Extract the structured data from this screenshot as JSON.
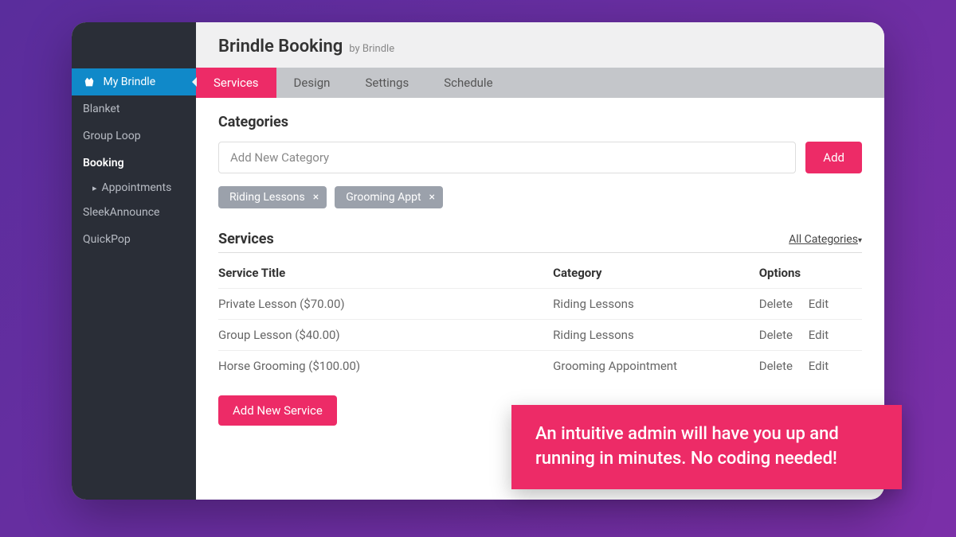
{
  "sidebar": {
    "brand": "My Brindle",
    "items": [
      "Blanket",
      "Group Loop",
      "Booking",
      "SleekAnnounce",
      "QuickPop"
    ],
    "sub_booking": "Appointments"
  },
  "header": {
    "title": "Brindle Booking",
    "by": "by Brindle"
  },
  "tabs": [
    "Services",
    "Design",
    "Settings",
    "Schedule"
  ],
  "categories": {
    "title": "Categories",
    "placeholder": "Add New Category",
    "add_label": "Add",
    "tags": [
      "Riding Lessons",
      "Grooming Appt"
    ]
  },
  "services": {
    "title": "Services",
    "filter_label": "All Categories",
    "columns": [
      "Service Title",
      "Category",
      "Options"
    ],
    "rows": [
      {
        "title": "Private Lesson ($70.00)",
        "category": "Riding Lessons"
      },
      {
        "title": "Group Lesson ($40.00)",
        "category": "Riding Lessons"
      },
      {
        "title": "Horse Grooming ($100.00)",
        "category": "Grooming Appointment"
      }
    ],
    "delete_label": "Delete",
    "edit_label": "Edit",
    "add_new_label": "Add New Service"
  },
  "callout": "An intuitive admin will have you up and running in minutes. No coding needed!"
}
